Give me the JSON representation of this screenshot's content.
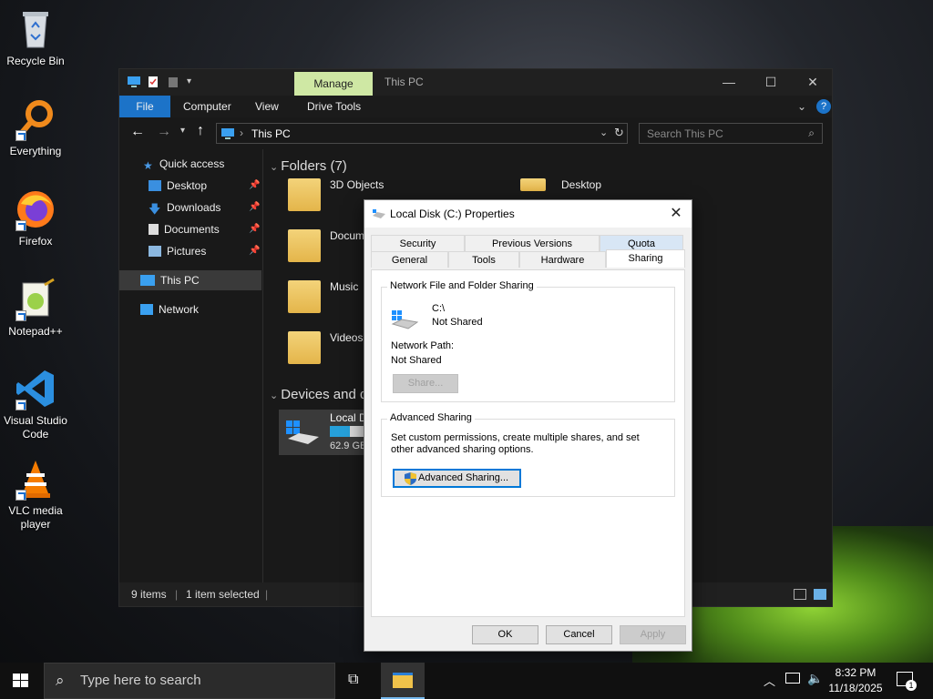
{
  "desktop": {
    "icons": [
      {
        "label": "Recycle Bin"
      },
      {
        "label": "Everything"
      },
      {
        "label": "Firefox"
      },
      {
        "label": "Notepad++"
      },
      {
        "label": "Visual Studio Code"
      },
      {
        "label": "VLC media player"
      }
    ]
  },
  "explorer": {
    "title": "This PC",
    "manage_tab": "Manage",
    "ribbon_tabs": [
      "File",
      "Computer",
      "View",
      "Drive Tools"
    ],
    "address": "This PC",
    "search_placeholder": "Search This PC",
    "nav": {
      "quick_access": "Quick access",
      "pinned": [
        "Desktop",
        "Downloads",
        "Documents",
        "Pictures"
      ],
      "this_pc": "This PC",
      "network": "Network"
    },
    "folders_header": "Folders (7)",
    "folders": [
      "3D Objects",
      "Desktop",
      "Docum",
      "Music",
      "Videos"
    ],
    "devices_header": "Devices and d",
    "drive": {
      "label": "Local D",
      "free": "62.9 GB",
      "used_fraction": 0.5
    },
    "status": {
      "items": "9 items",
      "selected": "1 item selected"
    }
  },
  "dialog": {
    "title": "Local Disk (C:) Properties",
    "tabs_row1": [
      "Security",
      "Previous Versions",
      "Quota"
    ],
    "tabs_row2": [
      "General",
      "Tools",
      "Hardware",
      "Sharing"
    ],
    "active_tab": "Sharing",
    "network_sharing": {
      "label": "Network File and Folder Sharing",
      "drive": "C:\\",
      "state": "Not Shared",
      "path_label": "Network Path:",
      "path_value": "Not Shared",
      "share_button": "Share..."
    },
    "advanced_sharing": {
      "label": "Advanced Sharing",
      "description": "Set custom permissions, create multiple shares, and set other advanced sharing options.",
      "button": "Advanced Sharing..."
    },
    "buttons": {
      "ok": "OK",
      "cancel": "Cancel",
      "apply": "Apply"
    }
  },
  "taskbar": {
    "search_placeholder": "Type here to search",
    "time": "8:32 PM",
    "date": "11/18/2025",
    "notification_count": "1"
  }
}
